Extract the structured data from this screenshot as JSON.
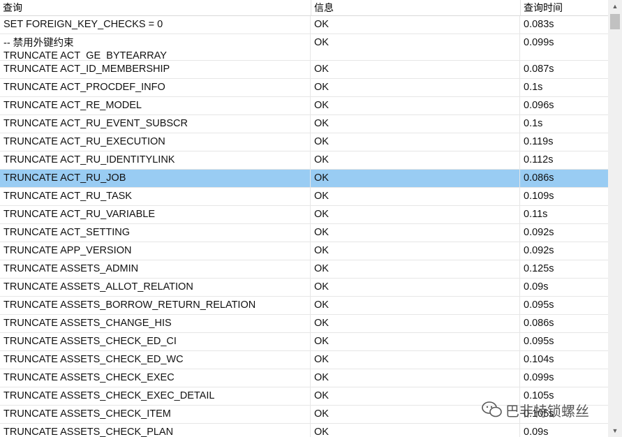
{
  "columns": [
    "查询",
    "信息",
    "查询时间"
  ],
  "rows": [
    {
      "query": "SET FOREIGN_KEY_CHECKS = 0",
      "info": "OK",
      "time": "0.083s"
    },
    {
      "query": "-- 禁用外键约束\nTRUNCATE ACT_GE_BYTEARRAY",
      "info": "OK",
      "time": "0.099s"
    },
    {
      "query": "TRUNCATE ACT_ID_MEMBERSHIP",
      "info": "OK",
      "time": "0.087s"
    },
    {
      "query": "TRUNCATE ACT_PROCDEF_INFO",
      "info": "OK",
      "time": "0.1s"
    },
    {
      "query": "TRUNCATE ACT_RE_MODEL",
      "info": "OK",
      "time": "0.096s"
    },
    {
      "query": "TRUNCATE ACT_RU_EVENT_SUBSCR",
      "info": "OK",
      "time": "0.1s"
    },
    {
      "query": "TRUNCATE ACT_RU_EXECUTION",
      "info": "OK",
      "time": "0.119s"
    },
    {
      "query": "TRUNCATE ACT_RU_IDENTITYLINK",
      "info": "OK",
      "time": "0.112s"
    },
    {
      "query": "TRUNCATE ACT_RU_JOB",
      "info": "OK",
      "time": "0.086s"
    },
    {
      "query": "TRUNCATE ACT_RU_TASK",
      "info": "OK",
      "time": "0.109s"
    },
    {
      "query": "TRUNCATE ACT_RU_VARIABLE",
      "info": "OK",
      "time": "0.11s"
    },
    {
      "query": "TRUNCATE ACT_SETTING",
      "info": "OK",
      "time": "0.092s"
    },
    {
      "query": "TRUNCATE APP_VERSION",
      "info": "OK",
      "time": "0.092s"
    },
    {
      "query": "TRUNCATE ASSETS_ADMIN",
      "info": "OK",
      "time": "0.125s"
    },
    {
      "query": "TRUNCATE ASSETS_ALLOT_RELATION",
      "info": "OK",
      "time": "0.09s"
    },
    {
      "query": "TRUNCATE ASSETS_BORROW_RETURN_RELATION",
      "info": "OK",
      "time": "0.095s"
    },
    {
      "query": "TRUNCATE ASSETS_CHANGE_HIS",
      "info": "OK",
      "time": "0.086s"
    },
    {
      "query": "TRUNCATE ASSETS_CHECK_ED_CI",
      "info": "OK",
      "time": "0.095s"
    },
    {
      "query": "TRUNCATE ASSETS_CHECK_ED_WC",
      "info": "OK",
      "time": "0.104s"
    },
    {
      "query": "TRUNCATE ASSETS_CHECK_EXEC",
      "info": "OK",
      "time": "0.099s"
    },
    {
      "query": "TRUNCATE ASSETS_CHECK_EXEC_DETAIL",
      "info": "OK",
      "time": "0.105s"
    },
    {
      "query": "TRUNCATE ASSETS_CHECK_ITEM",
      "info": "OK",
      "time": "0.105s"
    },
    {
      "query": "TRUNCATE ASSETS_CHECK_PLAN",
      "info": "OK",
      "time": "0.09s"
    }
  ],
  "selected_row": 8,
  "watermark": "巴非特锁螺丝",
  "colors": {
    "selected": "#99ccf3",
    "grid": "#e6e6e6"
  }
}
